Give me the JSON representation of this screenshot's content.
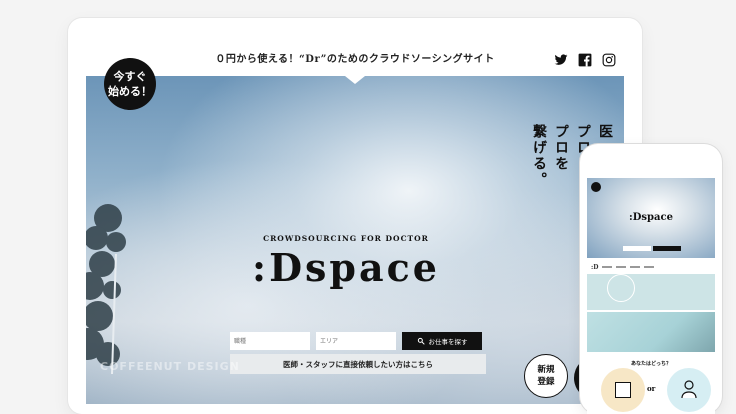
{
  "site": {
    "tagline": "０円から使える！“Dr”のためのクラウドソーシングサイト",
    "start_badge": "今すぐ\n始める！",
    "vertical_copy": "医\nプロと\nプロを\n繋げる。",
    "logo_sub": "CROWDSOURCING FOR DOCTOR",
    "logo_main": ":Dspace",
    "search": {
      "job_placeholder": "職種",
      "area_placeholder": "エリア",
      "submit_label": "お仕事を探す"
    },
    "request_label": "医師・スタッフに直接依頼したい方はこちら",
    "watermark": "COFFEENUT DESIGN",
    "register_badge": "新規\n登録",
    "social": [
      "twitter-icon",
      "facebook-icon",
      "instagram-icon"
    ]
  },
  "mobile": {
    "logo": ":Dspace",
    "nav_logo": ":D",
    "question": "あなたはどっち？",
    "or": "or"
  },
  "colors": {
    "accent_dark": "#111111",
    "sky_top": "#6c95b8",
    "teal": "#a7d2d7",
    "cream": "#f7e7c6"
  }
}
